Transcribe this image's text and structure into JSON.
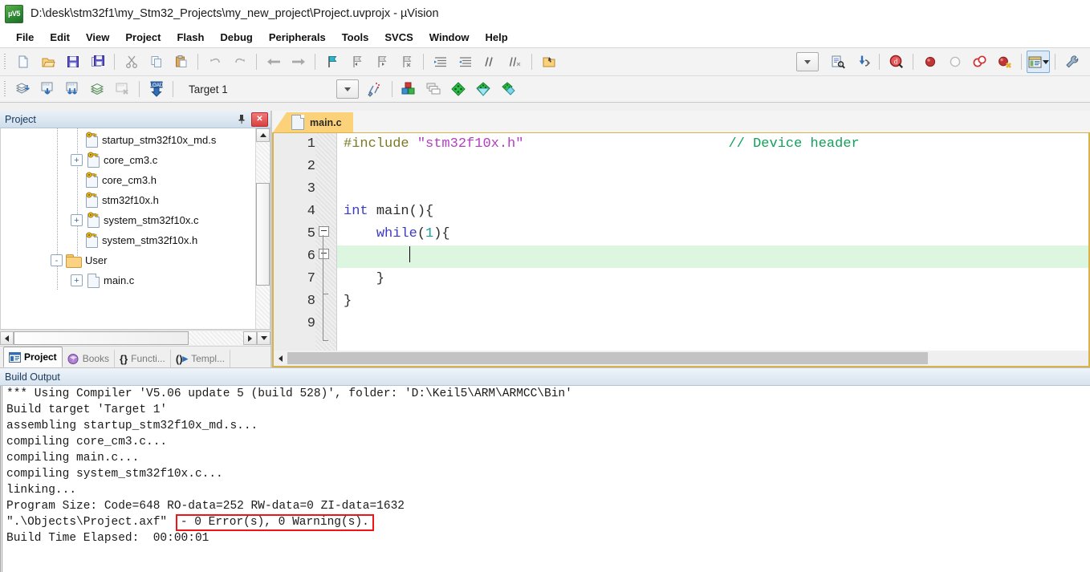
{
  "window": {
    "title": "D:\\desk\\stm32f1\\my_Stm32_Projects\\my_new_project\\Project.uvprojx - µVision",
    "app_icon": "uvision-icon",
    "icon_text": "µV5"
  },
  "menubar": {
    "items": [
      "File",
      "Edit",
      "View",
      "Project",
      "Flash",
      "Debug",
      "Peripherals",
      "Tools",
      "SVCS",
      "Window",
      "Help"
    ]
  },
  "toolbar_main": {
    "groups": [
      [
        "new-file-icon",
        "open-file-icon",
        "save-icon",
        "save-all-icon"
      ],
      [
        "cut-icon",
        "copy-icon",
        "paste-icon"
      ],
      [
        "undo-icon",
        "redo-icon"
      ],
      [
        "navigate-back-icon",
        "navigate-forward-icon"
      ],
      [
        "bookmark-toggle-icon",
        "bookmark-prev-icon",
        "bookmark-next-icon",
        "bookmark-clear-icon"
      ],
      [
        "indent-icon",
        "outdent-icon",
        "comment-icon",
        "uncomment-icon"
      ],
      [
        "open-folder-icon"
      ]
    ],
    "right_groups": [
      [
        "dropdown-arrow-icon"
      ],
      [
        "find-in-files-icon",
        "configure-icon"
      ],
      [
        "start-debug-icon"
      ],
      [
        "insert-breakpoint-icon",
        "disable-breakpoint-icon",
        "kill-all-breakpoints-icon",
        "disable-all-breakpoints-icon"
      ],
      [
        "window-layout-icon"
      ],
      [
        "settings-wrench-icon"
      ]
    ]
  },
  "toolbar_build": {
    "left_icons": [
      "translate-icon",
      "build-target-icon",
      "rebuild-all-icon",
      "batch-build-icon",
      "stop-build-icon",
      "download-icon"
    ],
    "target_selector": {
      "value": "Target 1",
      "dropdown_icon": "chevron-down-icon"
    },
    "right_icons": [
      "target-options-icon",
      "manage-components-icon",
      "multi-project-icon",
      "pack-installer-icon",
      "manage-run-time-icon",
      "pack-manager-icon"
    ]
  },
  "project_panel": {
    "title": "Project",
    "pin_icon": "pin-icon",
    "close_icon": "close-icon",
    "tree": [
      {
        "label": "startup_stm32f10x_md.s",
        "indent": 2,
        "expander": "",
        "icon": "source-file-key-icon"
      },
      {
        "label": "core_cm3.c",
        "indent": 2,
        "expander": "+",
        "icon": "source-file-key-icon"
      },
      {
        "label": "core_cm3.h",
        "indent": 2,
        "expander": "",
        "icon": "source-file-key-icon"
      },
      {
        "label": "stm32f10x.h",
        "indent": 2,
        "expander": "",
        "icon": "source-file-key-icon"
      },
      {
        "label": "system_stm32f10x.c",
        "indent": 2,
        "expander": "+",
        "icon": "source-file-key-icon"
      },
      {
        "label": "system_stm32f10x.h",
        "indent": 2,
        "expander": "",
        "icon": "source-file-key-icon"
      },
      {
        "label": "User",
        "indent": 1,
        "expander": "-",
        "icon": "folder-icon"
      },
      {
        "label": "main.c",
        "indent": 2,
        "expander": "+",
        "icon": "plain-file-icon"
      }
    ],
    "tabs": [
      {
        "label": "Project",
        "icon": "project-icon",
        "active": true
      },
      {
        "label": "Books",
        "icon": "books-icon",
        "active": false
      },
      {
        "label": "Functi...",
        "icon": "functions-icon",
        "active": false
      },
      {
        "label": "Templ...",
        "icon": "templates-icon",
        "active": false
      }
    ]
  },
  "editor": {
    "tabs": [
      {
        "label": "main.c",
        "icon": "file-icon",
        "active": true
      }
    ],
    "lines": [
      {
        "n": "1",
        "tokens": [
          {
            "t": "#include ",
            "c": "k-pre"
          },
          {
            "t": "\"stm32f10x.h\"",
            "c": "k-str"
          },
          {
            "t": "                         ",
            "c": "k-plain"
          },
          {
            "t": "// Device header",
            "c": "k-cmt"
          }
        ],
        "fold": "",
        "highlight": false
      },
      {
        "n": "2",
        "tokens": [],
        "fold": "",
        "highlight": false
      },
      {
        "n": "3",
        "tokens": [],
        "fold": "",
        "highlight": false
      },
      {
        "n": "4",
        "tokens": [
          {
            "t": "int ",
            "c": "k-kw"
          },
          {
            "t": "main(){",
            "c": "k-plain"
          }
        ],
        "fold": "box",
        "highlight": false
      },
      {
        "n": "5",
        "tokens": [
          {
            "t": "    ",
            "c": "k-plain"
          },
          {
            "t": "while",
            "c": "k-kw"
          },
          {
            "t": "(",
            "c": "k-plain"
          },
          {
            "t": "1",
            "c": "k-num"
          },
          {
            "t": "){",
            "c": "k-plain"
          }
        ],
        "fold": "box",
        "highlight": false
      },
      {
        "n": "6",
        "tokens": [
          {
            "t": "        ",
            "c": "k-plain"
          }
        ],
        "fold": "line",
        "highlight": true,
        "caret": true
      },
      {
        "n": "7",
        "tokens": [
          {
            "t": "    }",
            "c": "k-plain"
          }
        ],
        "fold": "endin",
        "highlight": false
      },
      {
        "n": "8",
        "tokens": [
          {
            "t": "}",
            "c": "k-plain"
          }
        ],
        "fold": "line",
        "highlight": false
      },
      {
        "n": "9",
        "tokens": [],
        "fold": "endout",
        "highlight": false
      }
    ]
  },
  "build_output": {
    "title": "Build Output",
    "lines": [
      {
        "text": "*** Using Compiler 'V5.06 update 5 (build 528)', folder: 'D:\\Keil5\\ARM\\ARMCC\\Bin'"
      },
      {
        "text": "Build target 'Target 1'"
      },
      {
        "text": "assembling startup_stm32f10x_md.s..."
      },
      {
        "text": "compiling core_cm3.c..."
      },
      {
        "text": "compiling main.c..."
      },
      {
        "text": "compiling system_stm32f10x.c..."
      },
      {
        "text": "linking..."
      },
      {
        "text": "Program Size: Code=648 RO-data=252 RW-data=0 ZI-data=1632"
      },
      {
        "text": "\".\\Objects\\Project.axf\" ",
        "boxed": "- 0 Error(s), 0 Warning(s)."
      },
      {
        "text": "Build Time Elapsed:  00:00:01"
      }
    ]
  },
  "colors": {
    "accent_tab": "#fbd279",
    "tab_border": "#d8b24a",
    "error_box": "#f01414",
    "highlight_line": "#ddf6e0",
    "comment": "#13a05a",
    "keyword": "#3b3bc8",
    "string": "#b23ec0",
    "preprocessor": "#7a7a22",
    "number": "#1aa0a0"
  }
}
